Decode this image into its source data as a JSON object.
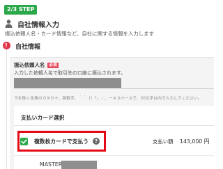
{
  "step": {
    "label": "2/3 STEP"
  },
  "header": {
    "title": "自社情報入力",
    "description": "振込依頼人名・カード情報など、自社に関する情報を入力します",
    "icon": "person-icon"
  },
  "section": {
    "title": "自社情報",
    "alert_icon": "!",
    "alert_color": "#e0334a"
  },
  "payer_name_field": {
    "label": "振込依頼人名",
    "required_tag": "必須",
    "help": "入力した依頼人名で取引先の口座に振込されます。",
    "note": "ヲを除く全角のカタカナ、英数字、｀＾（）「」／、ー￥スペースで、30文字以内で入力してください。"
  },
  "card_selection": {
    "title": "支払いカード選択",
    "multi_card_label": "複数枚カードで支払う",
    "multi_card_checked": true,
    "help_icon": "?",
    "payment_label": "支払い額",
    "payment_amount": "143,000 円"
  },
  "card_list": [
    {
      "brand": "MASTER",
      "logo": "mastercard-logo-icon"
    }
  ],
  "colors": {
    "accent_green": "#2aa84a",
    "highlight_red": "#e40a14",
    "required_red": "#e8465a"
  }
}
